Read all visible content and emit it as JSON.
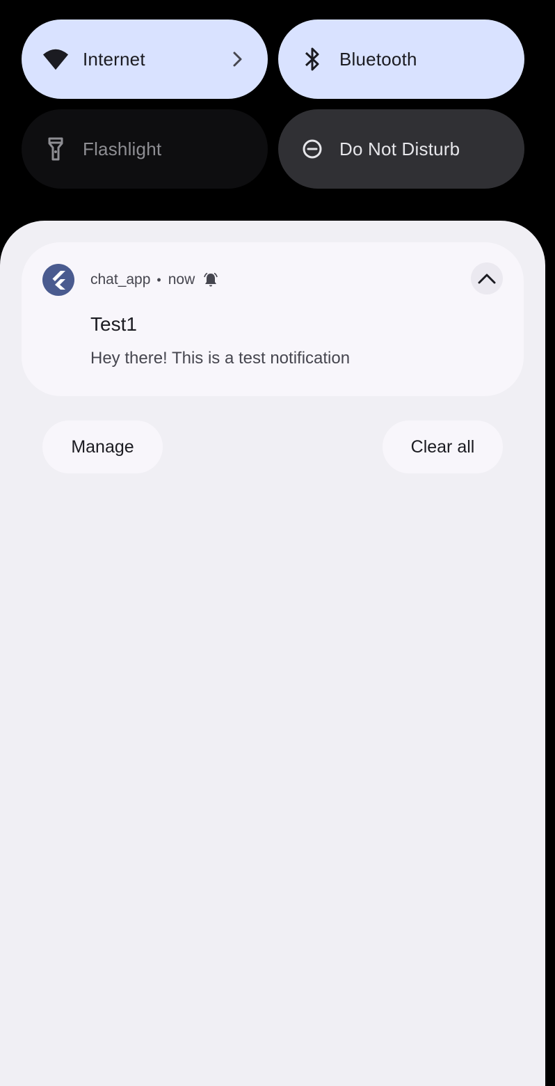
{
  "quick_settings": {
    "tiles": [
      {
        "label": "Internet",
        "icon": "wifi-icon",
        "state": "on",
        "has_chevron": true
      },
      {
        "label": "Bluetooth",
        "icon": "bluetooth-icon",
        "state": "on"
      },
      {
        "label": "Flashlight",
        "icon": "flashlight-icon",
        "state": "unavailable"
      },
      {
        "label": "Do Not Disturb",
        "icon": "do-not-disturb-icon",
        "state": "off"
      }
    ]
  },
  "notification": {
    "app_name": "chat_app",
    "separator": "•",
    "time": "now",
    "app_icon": "flutter-logo-icon",
    "alert_icon": "bell-icon",
    "title": "Test1",
    "body": "Hey there! This is a test notification",
    "expand_icon": "chevron-up-icon"
  },
  "actions": {
    "manage_label": "Manage",
    "clear_all_label": "Clear all"
  },
  "colors": {
    "tile_on": "#d9e2ff",
    "tile_off": "#303034",
    "shade_bg": "#f0eff4",
    "card_bg": "#f8f6fb",
    "app_icon_bg": "#4a5b8f"
  }
}
